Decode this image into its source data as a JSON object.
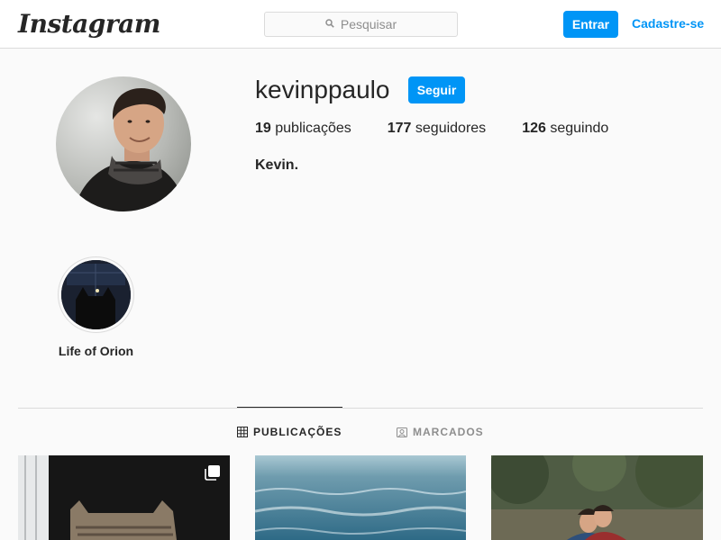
{
  "header": {
    "logo": "Instagram",
    "search_placeholder": "Pesquisar",
    "login_label": "Entrar",
    "signup_label": "Cadastre-se"
  },
  "profile": {
    "username": "kevinppaulo",
    "follow_label": "Seguir",
    "posts_count": "19",
    "posts_label": "publicações",
    "followers_count": "177",
    "followers_label": "seguidores",
    "following_count": "126",
    "following_label": "seguindo",
    "full_name": "Kevin."
  },
  "highlights": [
    {
      "label": "Life of Orion"
    }
  ],
  "tabs": {
    "posts": "PUBLICAÇÕES",
    "tagged": "MARCADOS"
  },
  "colors": {
    "accent": "#0095f6",
    "text": "#262626",
    "muted": "#8e8e8e",
    "border": "#dbdbdb",
    "background": "#fafafa"
  }
}
